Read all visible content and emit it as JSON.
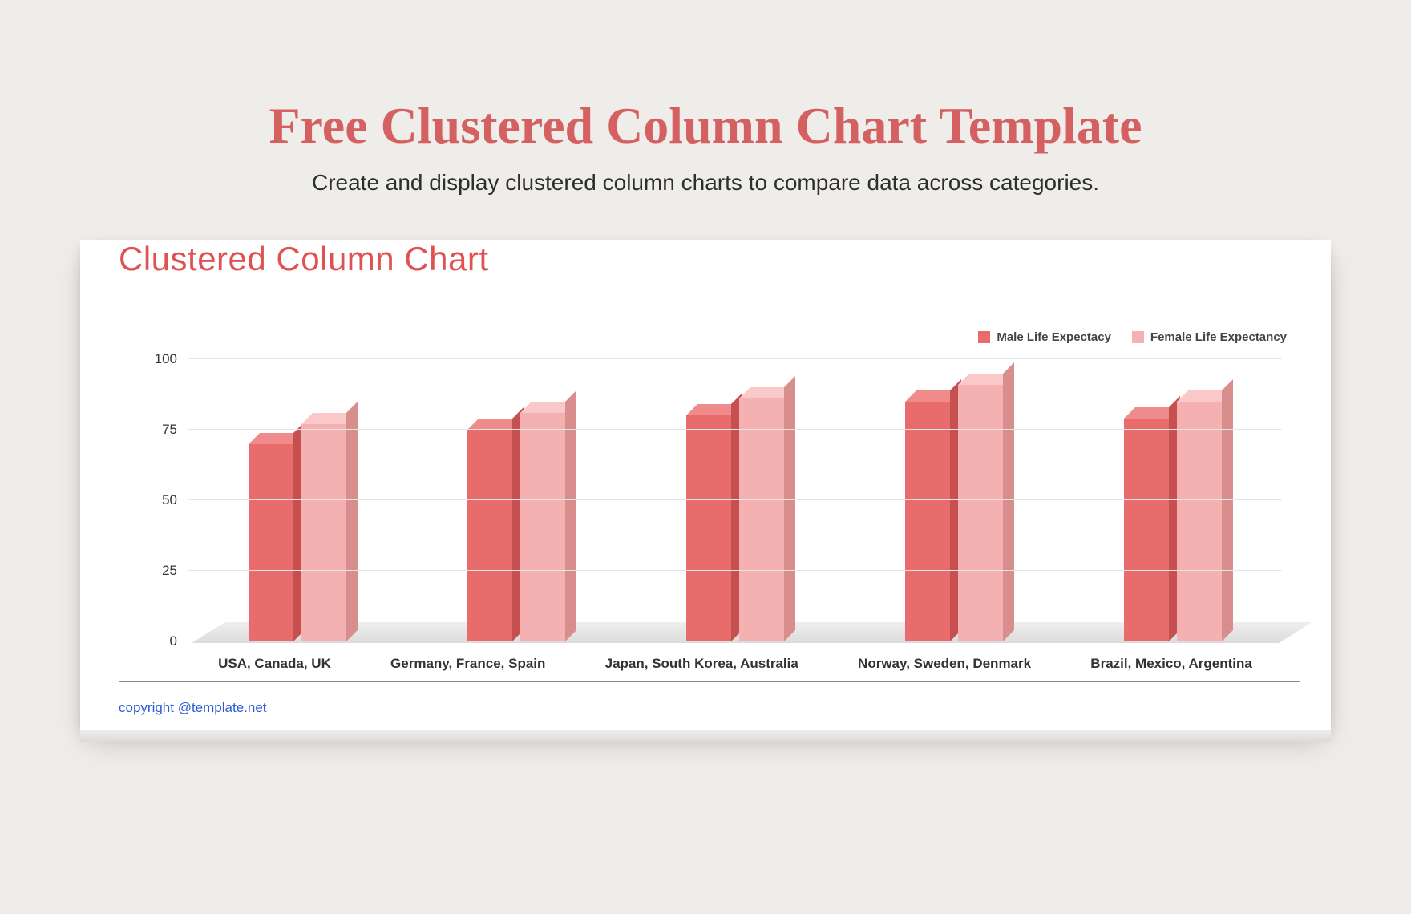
{
  "page": {
    "title": "Free Clustered Column Chart Template",
    "subtitle": "Create and display clustered column charts to compare data across categories."
  },
  "card": {
    "chart_title": "Clustered Column Chart",
    "copyright": "copyright @template.net"
  },
  "legend": {
    "series1": "Male Life Expectacy",
    "series2": "Female Life Expectancy"
  },
  "colors": {
    "male_front": "#e86c6c",
    "male_top": "#f08b8b",
    "male_side": "#c64f4f",
    "female_front": "#f5b1b1",
    "female_top": "#fac8c8",
    "female_side": "#d98e8e",
    "swatch_male": "#e86c6c",
    "swatch_female": "#f5b1b1"
  },
  "chart_data": {
    "type": "bar",
    "title": "Clustered Column Chart",
    "xlabel": "",
    "ylabel": "",
    "ylim": [
      0,
      100
    ],
    "yticks": [
      0,
      25,
      50,
      75,
      100
    ],
    "categories": [
      "USA, Canada, UK",
      "Germany, France, Spain",
      "Japan, South Korea, Australia",
      "Norway, Sweden, Denmark",
      "Brazil, Mexico, Argentina"
    ],
    "series": [
      {
        "name": "Male Life Expectacy",
        "values": [
          70,
          75,
          80,
          85,
          79
        ]
      },
      {
        "name": "Female Life Expectancy",
        "values": [
          77,
          81,
          86,
          91,
          85
        ]
      }
    ]
  }
}
